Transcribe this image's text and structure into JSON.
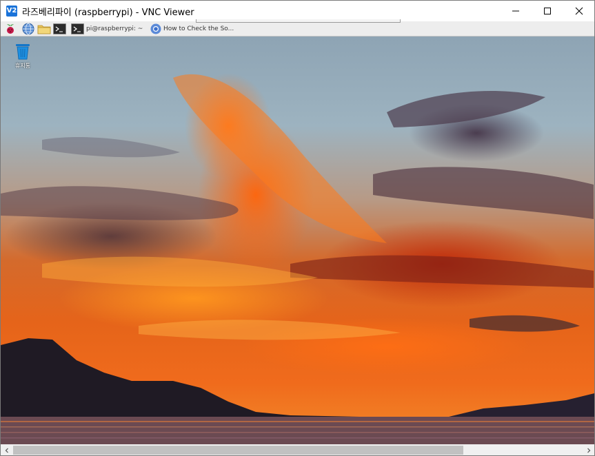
{
  "window": {
    "app_icon_text": "V2",
    "title": "라즈베리파이 (raspberrypi) - VNC Viewer",
    "minimize_icon": "minimize-icon",
    "maximize_icon": "maximize-icon",
    "close_icon": "close-icon"
  },
  "taskbar": {
    "launchers": [
      "raspberry-menu-icon",
      "web-browser-icon",
      "file-manager-icon",
      "terminal-icon"
    ],
    "tasks": [
      {
        "icon": "terminal-icon",
        "label": "pi@raspberrypi: ~"
      },
      {
        "icon": "chromium-icon",
        "label": "How to Check the So..."
      }
    ]
  },
  "desktop": {
    "wallpaper": "sunset-clouds-over-lake",
    "icons": [
      {
        "icon": "trash-icon",
        "label": "휴지통"
      }
    ]
  },
  "scrollbar": {
    "orientation": "horizontal",
    "position": 0.0
  },
  "colors": {
    "taskbar_bg": "#ededed",
    "titlebar_bg": "#ffffff",
    "vnc_blue": "#1a73d9",
    "trash_blue": "#1e8fe0"
  }
}
